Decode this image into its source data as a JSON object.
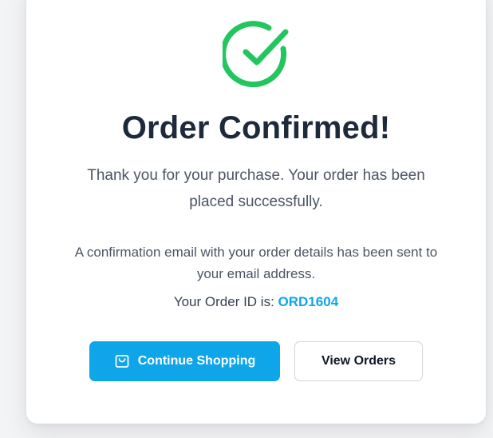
{
  "confirmation": {
    "icon": "check-circle-icon",
    "title": "Order Confirmed!",
    "subtitle": "Thank you for your purchase. Your order has been placed successfully.",
    "email_note": "A confirmation email with your order details has been sent to your email address.",
    "order_id_label": "Your Order ID is:",
    "order_id": "ORD1604"
  },
  "actions": {
    "continue_label": "Continue Shopping",
    "continue_icon": "shopping-bag-icon",
    "view_orders_label": "View Orders"
  },
  "colors": {
    "success": "#22c55e",
    "accent": "#0ea5e9",
    "heading": "#1e293b",
    "body_text": "#4b5563"
  }
}
